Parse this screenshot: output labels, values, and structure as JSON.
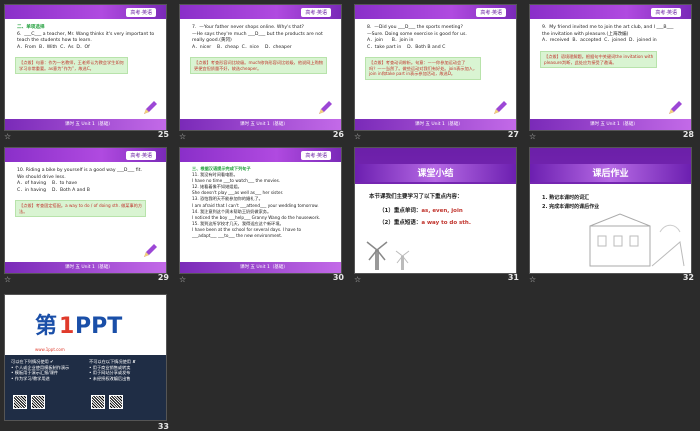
{
  "slides": [
    {
      "num": "25",
      "header_tag": "高考·英语",
      "lines": [
        "二、单项选择",
        "6.  ___C___ a teacher, Mr. Wang thinks it's very important to",
        "teach the students how to learn.",
        "A．From  B．With  C．As  D．Of"
      ],
      "answer": "C",
      "note": "【点拨】句意：作为一名教师，王老师认为教会学生如何\n学习非常重要。as意为“作为”，故选C。"
    },
    {
      "num": "26",
      "header_tag": "高考·英语",
      "lines": [
        "7.  —Your father never shops online. Why's that?",
        "—He says they're much ___D___ but the products are not",
        "really good.(黄冈)",
        "A．nicer    B．cheap  C．nice    D．cheaper"
      ],
      "answer": "D",
      "note": "【点拨】考查形容词比较级。much修饰形容词比较级，他说网上购物\n更便宜但质量不好，故选cheaper。"
    },
    {
      "num": "27",
      "header_tag": "高考·英语",
      "lines": [
        "8.  —Did you ___D___ the sports meeting?",
        "—Sure. Doing some exercise is good for us.",
        "A．join      B．join in",
        "C．take part in    D．Both B and C"
      ],
      "answer": "D",
      "note": "【点拨】考查动词辨析。句意：——你参加运动会了\n吗？——当然了。做些运动对我们有好处。join表示加入，\njoin in和take part in表示参加活动，故选D。"
    },
    {
      "num": "28",
      "header_tag": "高考·英语",
      "lines": [
        "9.  My friend invited me to join the art club, and I ___B___",
        "the invitation with pleasure.(上海改编)",
        "A．received  B．accepted  C．joined  D．joined in"
      ],
      "answer": "B",
      "note": "【点拨】语境理解题。根据句中关键词the invitation with\npleasure判断，此处应为接受了邀请。"
    },
    {
      "num": "29",
      "header_tag": "高考·英语",
      "lines": [
        "10. Riding a bike by yourself is a good way ___D___ fit.",
        "We should drive less.",
        "A．of having    B．to have",
        "C．in having    D．Both A and B"
      ],
      "answer": "D",
      "note": "【点拨】考查固定搭配。a way to do / of doing sth. 做某事的方\n法。"
    },
    {
      "num": "30",
      "header_tag": "高考·英语",
      "section": "三、根据汉语提示完成下列句子",
      "lines": [
        "11. 我没有时间看电影。",
        "I have no time ___to watch___ the movies.",
        "12. 她看着像不如她姐姐。",
        "She doesn't play ___as well as___ her sister.",
        "13. 恐怕我明天不能参加你的婚礼了。",
        "I am afraid that I can't ___attend___ your wedding tomorrow.",
        "14. 我注意到这个周末帮助王奶奶做家务。",
        "I noticed the boy ___help___ Granny Wang do the housework.",
        "15. 我到这所学校才几天，我得适应这个新环境。",
        "I have been at the school for several days. I have to",
        "___adapt___ ___to___ the new environment."
      ]
    },
    {
      "num": "31",
      "title": "课堂小结",
      "heading": "本节课我们主要学习了以下重点内容：",
      "points": [
        {
          "label": "（1）重点单词：",
          "value": "as, even, join"
        },
        {
          "label": "（2）重点短语：",
          "value": "a way to do sth."
        }
      ]
    },
    {
      "num": "32",
      "title": "课后作业",
      "tasks": [
        "1. 熟记本课时的词汇",
        "2. 完成本课时的课后作业"
      ]
    },
    {
      "num": "33",
      "logo_main": "第1PPT",
      "logo_sub": "www.1ppt.com",
      "left_col": "可以在下列情况使用 ✔\n• 个人或企业使用模板制作演示\n• 模板用于演示汇报/课件\n• 作为学习/教学用途",
      "right_col": "不可以在以下情况使用 ✘\n• 用于商业销售或转卖\n• 用于网站分享或发布\n• 未经授权改编后出售"
    }
  ],
  "footer_text": "课时 五   Unit 1（基础）",
  "colors": {
    "purple": "#8a2fc9",
    "green_note": "#d9f4d2",
    "answer_red": "#c0322b",
    "dark_band": "#1f2d45"
  }
}
